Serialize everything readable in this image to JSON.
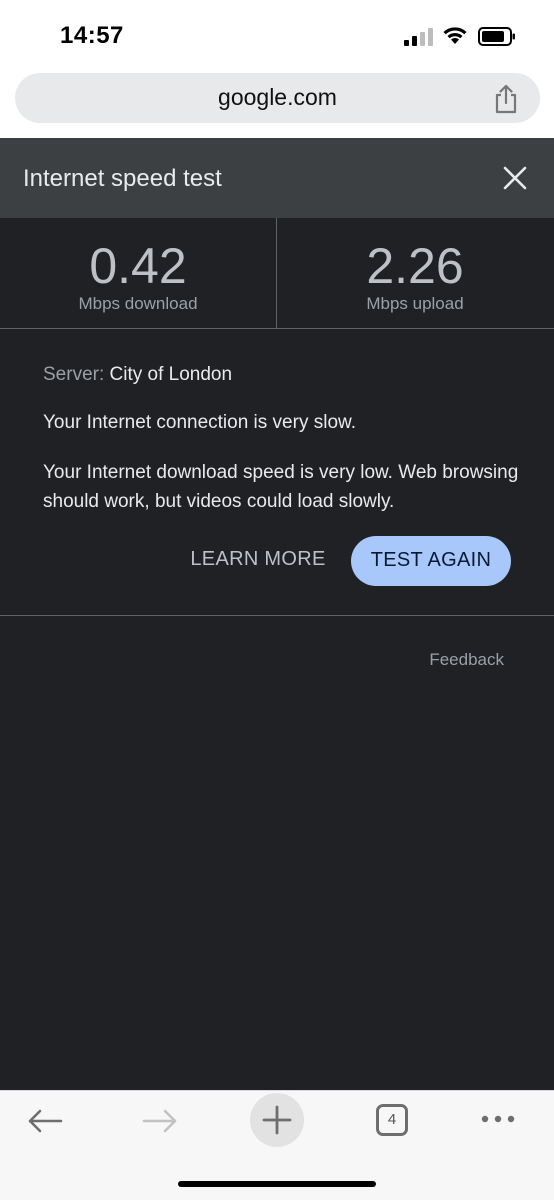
{
  "status_bar": {
    "time": "14:57"
  },
  "address_bar": {
    "url": "google.com"
  },
  "panel": {
    "title": "Internet speed test",
    "download": {
      "value": "0.42",
      "unit": "Mbps download"
    },
    "upload": {
      "value": "2.26",
      "unit": "Mbps upload"
    },
    "server_label": "Server:",
    "server_value": "City of London",
    "message_connection": "Your Internet connection is very slow.",
    "message_detail": "Your Internet download speed is very low. Web browsing should work, but videos could load slowly.",
    "learn_more_label": "LEARN MORE",
    "test_again_label": "TEST AGAIN",
    "feedback_label": "Feedback"
  },
  "toolbar": {
    "tab_count": "4"
  },
  "colors": {
    "panel_bg": "#202124",
    "header_bg": "#3c4043",
    "accent": "#a8c7fa"
  }
}
